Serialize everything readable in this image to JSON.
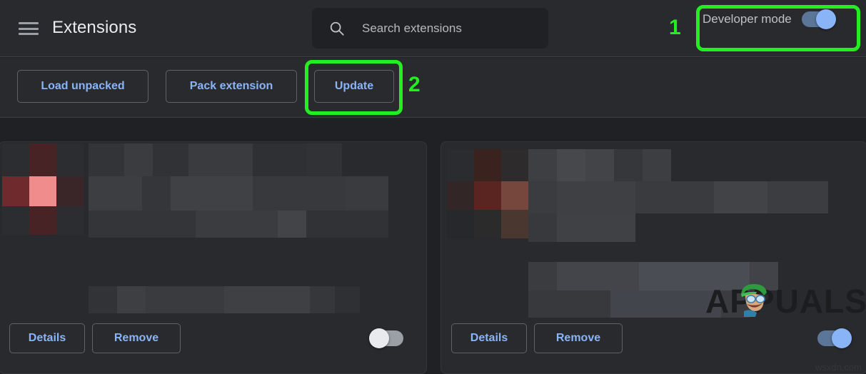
{
  "header": {
    "menu_icon": "hamburger-menu-icon",
    "title": "Extensions",
    "search": {
      "icon": "search-icon",
      "placeholder": "Search extensions",
      "value": ""
    },
    "developer_mode": {
      "label": "Developer mode",
      "state": "on"
    }
  },
  "toolbar": {
    "load_unpacked_label": "Load unpacked",
    "pack_extension_label": "Pack extension",
    "update_label": "Update"
  },
  "annotations": [
    {
      "number": "1",
      "target": "developer-mode-toggle",
      "color": "#22ee22"
    },
    {
      "number": "2",
      "target": "update-button",
      "color": "#22ee22"
    }
  ],
  "cards": [
    {
      "id": "extension-card-left",
      "name_blurred": true,
      "details_label": "Details",
      "remove_label": "Remove",
      "enabled_toggle_state": "off",
      "icon_colors": [
        "#2c2d30",
        "#472325",
        "#6e2a2c",
        "#f08c8c",
        "#3a2628"
      ],
      "blur_block_color": "#3a3c40"
    },
    {
      "id": "extension-card-right",
      "name_blurred": true,
      "details_label": "Details",
      "remove_label": "Remove",
      "enabled_toggle_state": "on",
      "icon_colors": [
        "#2b2c2f",
        "#3a221f",
        "#5a2421",
        "#76473c",
        "#4a3830"
      ],
      "blur_block_color": "#3d4045"
    }
  ],
  "watermarks": {
    "brand": "APPUALS",
    "footer": "wsxdn.com"
  },
  "colors": {
    "page_background": "#202124",
    "surface": "#292a2d",
    "accent_blue": "#8ab4f8",
    "toggle_on_track": "#5c7699",
    "toggle_off_track": "#9aa0a6",
    "annotation_green": "#22ee22",
    "text_primary": "#e8eaed",
    "text_secondary": "#bdc1c6",
    "border": "#5f6368"
  }
}
